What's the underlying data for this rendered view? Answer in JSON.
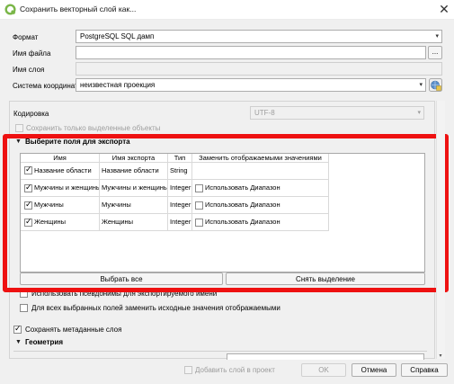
{
  "window": {
    "title": "Сохранить векторный слой как...",
    "close_glyph": "✕"
  },
  "form": {
    "format_label": "Формат",
    "format_value": "PostgreSQL SQL дамп",
    "filename_label": "Имя файла",
    "filename_value": "",
    "browse_label": "...",
    "layername_label": "Имя слоя",
    "layername_value": "",
    "crs_label": "Система координат",
    "crs_value": "неизвестная проекция"
  },
  "encoding": {
    "label": "Кодировка",
    "value": "UTF-8",
    "selected_only_label": "Сохранить только выделенные объекты",
    "selected_only_checked": false
  },
  "fields_section": {
    "title": "Выберите поля для экспорта",
    "columns": [
      "Имя",
      "Имя экспорта",
      "Тип",
      "Заменить отображаемыми значениями"
    ],
    "rows": [
      {
        "checked": true,
        "name": "Название области",
        "export_name": "Название области",
        "type": "String",
        "replace": "",
        "has_replace_box": false
      },
      {
        "checked": true,
        "name": "Мужчины и женщины",
        "export_name": "Мужчины и женщины",
        "type": "Integer",
        "replace": "Использовать Диапазон",
        "has_replace_box": true
      },
      {
        "checked": true,
        "name": "Мужчины",
        "export_name": "Мужчины",
        "type": "Integer",
        "replace": "Использовать Диапазон",
        "has_replace_box": true
      },
      {
        "checked": true,
        "name": "Женщины",
        "export_name": "Женщины",
        "type": "Integer",
        "replace": "Использовать Диапазон",
        "has_replace_box": true
      }
    ],
    "select_all_label": "Выбрать все",
    "deselect_label": "Снять выделение",
    "use_aliases_label": "Использовать псевдонимы для экспортируемого имени",
    "replace_all_label": "Для всех выбранных полей заменить исходные значения отображаемыми"
  },
  "metadata": {
    "label": "Сохранять метаданные слоя",
    "checked": true
  },
  "geometry": {
    "title": "Геометрия"
  },
  "footer": {
    "add_to_project_label": "Добавить слой в проект",
    "ok_label": "OK",
    "cancel_label": "Отмена",
    "help_label": "Справка"
  },
  "colors": {
    "highlight": "#ee1111",
    "qgis_green": "#7ab648"
  },
  "icons": {
    "app": "qgis-logo-icon",
    "crs": "globe-crs-icon",
    "combo": "chevron-down-icon",
    "section": "triangle-down-icon"
  }
}
